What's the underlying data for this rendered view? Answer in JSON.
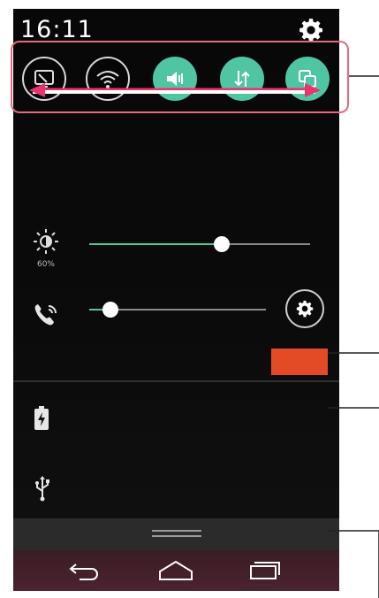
{
  "status_bar": {
    "time": "16:11",
    "settings_icon": "gear-icon"
  },
  "quick_settings": {
    "toggles": [
      {
        "name": "screen-share",
        "icon": "screen-share-icon",
        "state": "off"
      },
      {
        "name": "wifi",
        "icon": "wifi-icon",
        "state": "off"
      },
      {
        "name": "sound",
        "icon": "sound-icon",
        "state": "on"
      },
      {
        "name": "data",
        "icon": "data-icon",
        "state": "on"
      },
      {
        "name": "qslide",
        "icon": "qslide-icon",
        "state": "on"
      }
    ]
  },
  "brightness": {
    "icon": "brightness-icon",
    "percent_label": "60%",
    "level": 0.6
  },
  "volume": {
    "icon": "ringtone-icon",
    "level": 0.12,
    "settings_icon": "gear-icon"
  },
  "notifications": {
    "icons": [
      "battery-icon",
      "usb-icon"
    ]
  },
  "colors": {
    "accent": "#4fc5a4",
    "highlight": "#e24b26",
    "callout": "#e46a7a"
  }
}
